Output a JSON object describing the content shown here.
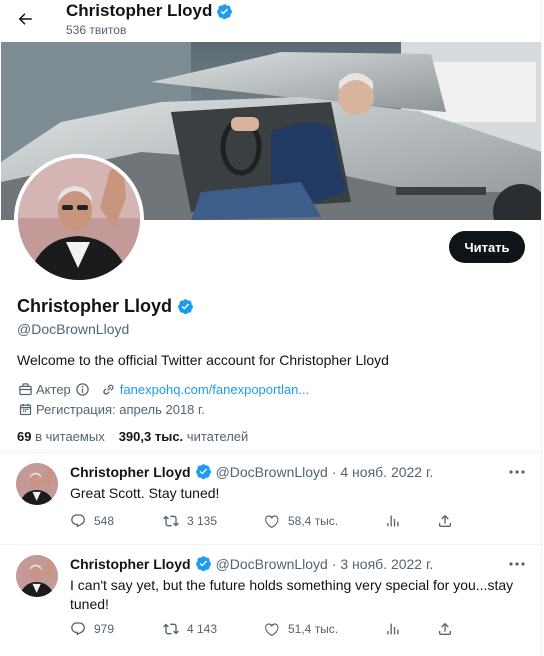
{
  "header": {
    "back_icon": "arrow-left-icon",
    "name": "Christopher Lloyd",
    "tweet_count": "536 твитов"
  },
  "profile": {
    "name": "Christopher Lloyd",
    "handle": "@DocBrownLloyd",
    "follow_label": "Читать",
    "bio": "Welcome to the official Twitter account for Christopher Lloyd",
    "profession": "Актер",
    "link": "fanexpohq.com/fanexpoportlan...",
    "joined": "Регистрация: апрель 2018 г.",
    "following_count": "69",
    "following_label": "в читаемых",
    "followers_count": "390,3 тыс.",
    "followers_label": "читателей"
  },
  "tweets": [
    {
      "name": "Christopher Lloyd",
      "handle": "@DocBrownLloyd",
      "date": "· 4 нояб. 2022 г.",
      "text": "Great Scott. Stay tuned!",
      "replies": "548",
      "retweets": "3 135",
      "likes": "58,4 тыс."
    },
    {
      "name": "Christopher Lloyd",
      "handle": "@DocBrownLloyd",
      "date": "· 3 нояб. 2022 г.",
      "text": "I can't say yet, but the future holds something very special for you...stay tuned!",
      "replies": "979",
      "retweets": "4 143",
      "likes": "51,4 тыс."
    }
  ],
  "colors": {
    "accent": "#1d9bf0",
    "text": "#0f1419",
    "secondary": "#536471",
    "button": "#0f1419"
  }
}
